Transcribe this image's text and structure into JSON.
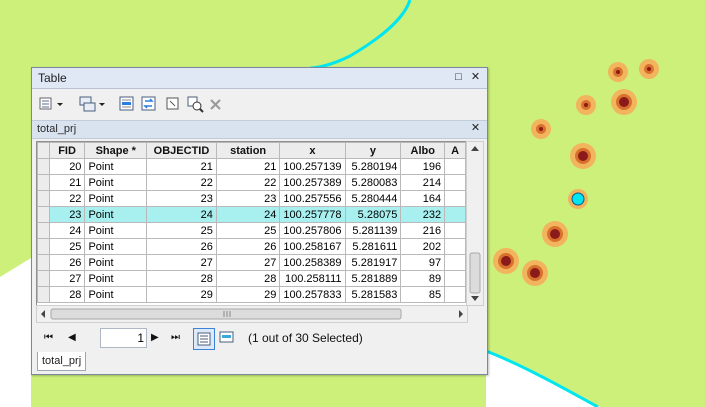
{
  "window": {
    "title": "Table",
    "maximize_glyph": "□",
    "close_glyph": "✕"
  },
  "toolbar": {
    "icons": [
      "table-options-icon",
      "related-tables-icon",
      "select-by-attributes-icon",
      "switch-selection-icon",
      "clear-selection-icon",
      "zoom-to-selected-icon",
      "delete-selected-icon"
    ]
  },
  "table_tab": {
    "name": "total_prj",
    "close_glyph": "✕"
  },
  "grid": {
    "columns": [
      "FID",
      "Shape *",
      "OBJECTID",
      "station",
      "x",
      "y",
      "Albo",
      "A"
    ],
    "rows": [
      {
        "fid": "20",
        "shape": "Point",
        "objectid": "21",
        "station": "21",
        "x": "100.257139",
        "y": "5.280194",
        "albo": "196",
        "selected": false
      },
      {
        "fid": "21",
        "shape": "Point",
        "objectid": "22",
        "station": "22",
        "x": "100.257389",
        "y": "5.280083",
        "albo": "214",
        "selected": false
      },
      {
        "fid": "22",
        "shape": "Point",
        "objectid": "23",
        "station": "23",
        "x": "100.257556",
        "y": "5.280444",
        "albo": "164",
        "selected": false
      },
      {
        "fid": "23",
        "shape": "Point",
        "objectid": "24",
        "station": "24",
        "x": "100.257778",
        "y": "5.28075",
        "albo": "232",
        "selected": true
      },
      {
        "fid": "24",
        "shape": "Point",
        "objectid": "25",
        "station": "25",
        "x": "100.257806",
        "y": "5.281139",
        "albo": "216",
        "selected": false
      },
      {
        "fid": "25",
        "shape": "Point",
        "objectid": "26",
        "station": "26",
        "x": "100.258167",
        "y": "5.281611",
        "albo": "202",
        "selected": false
      },
      {
        "fid": "26",
        "shape": "Point",
        "objectid": "27",
        "station": "27",
        "x": "100.258389",
        "y": "5.281917",
        "albo": "97",
        "selected": false
      },
      {
        "fid": "27",
        "shape": "Point",
        "objectid": "28",
        "station": "28",
        "x": "100.258111",
        "y": "5.281889",
        "albo": "89",
        "selected": false
      },
      {
        "fid": "28",
        "shape": "Point",
        "objectid": "29",
        "station": "29",
        "x": "100.257833",
        "y": "5.281583",
        "albo": "85",
        "selected": false
      }
    ]
  },
  "navigation": {
    "first_glyph": "⏮",
    "prev_glyph": "◀",
    "current_record": "1",
    "next_glyph": "▶",
    "last_glyph": "⏭",
    "selection_info": "(1 out of 30 Selected)"
  },
  "bottom_tab": "total_prj",
  "colors": {
    "map_background": "#cdf07a",
    "map_lower_area": "#ffffff",
    "boundary_line": "#00e5f0",
    "selected_row": "#a8f0f0",
    "selected_point": "#00e5f0",
    "point_halo": "#f2b45c",
    "point_ring": "#d8712e",
    "point_core": "#8b1a1a"
  }
}
